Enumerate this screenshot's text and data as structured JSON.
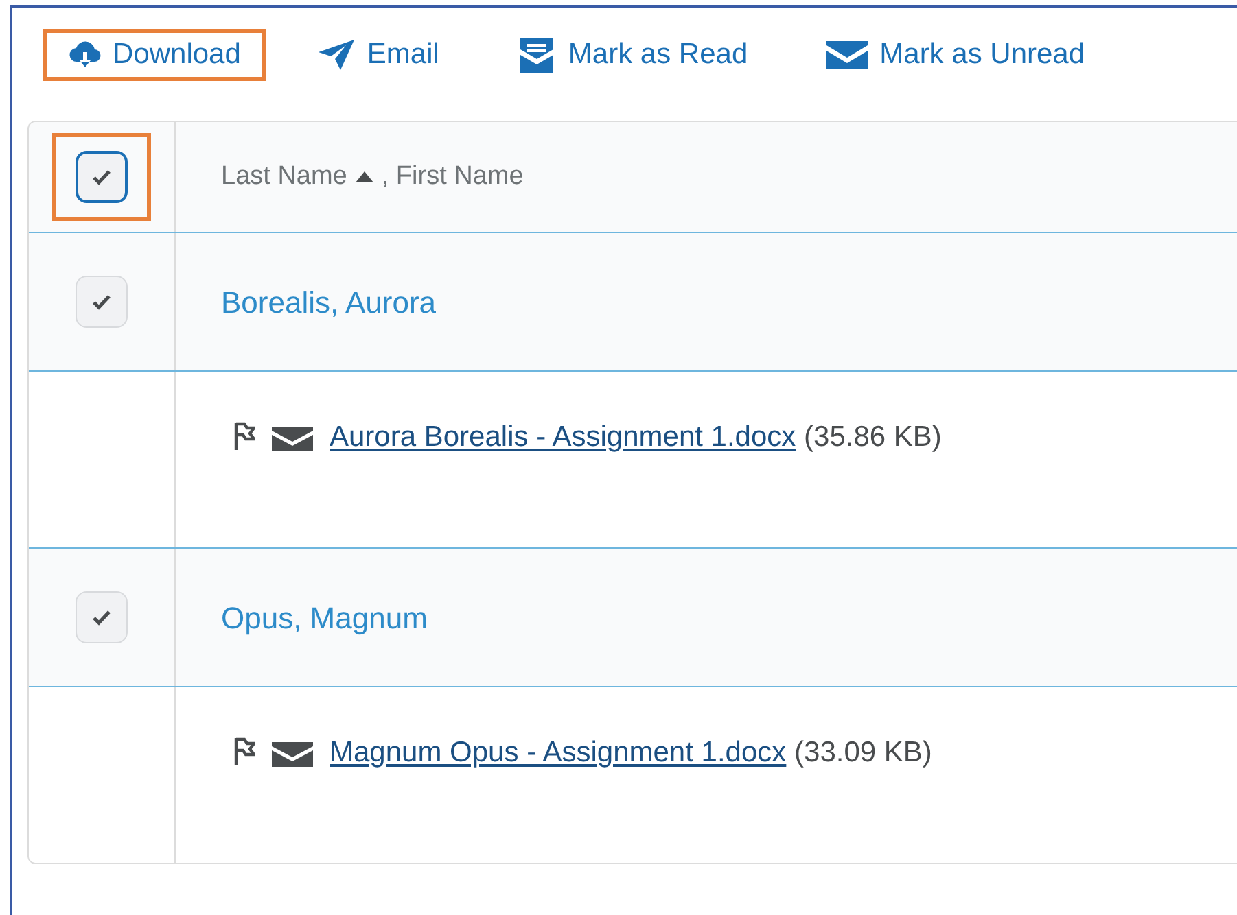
{
  "toolbar": [
    {
      "kind": "download",
      "label": "Download",
      "highlighted": true
    },
    {
      "kind": "email",
      "label": "Email",
      "highlighted": false
    },
    {
      "kind": "read",
      "label": "Mark as Read",
      "highlighted": false
    },
    {
      "kind": "unread",
      "label": "Mark as Unread",
      "highlighted": false
    }
  ],
  "table": {
    "header": {
      "checked": true,
      "highlighted": true,
      "last_name": "Last Name",
      "separator": ", First Name"
    },
    "rows": [
      {
        "checked": true,
        "name": "Borealis, Aurora",
        "file": "Aurora Borealis - Assignment 1.docx",
        "size": "(35.86 KB)"
      },
      {
        "checked": true,
        "name": "Opus, Magnum",
        "file": "Magnum Opus - Assignment 1.docx",
        "size": "(33.09 KB)"
      }
    ]
  }
}
